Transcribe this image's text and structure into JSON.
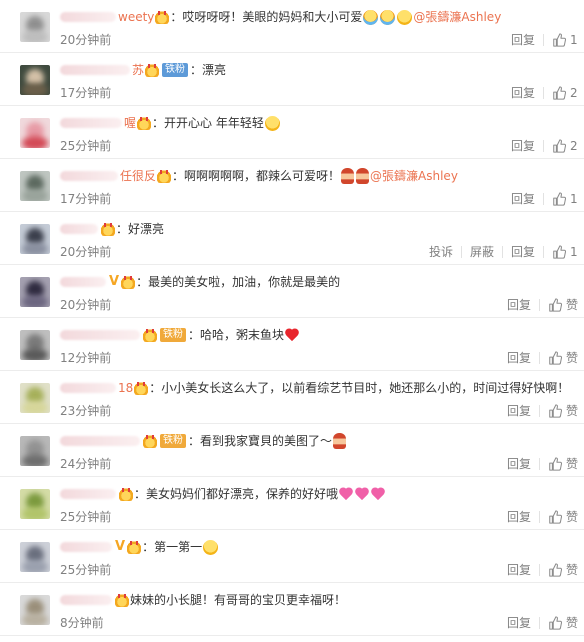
{
  "labels": {
    "reply": "回复",
    "report": "投诉",
    "block": "屏蔽",
    "like_text": "赞"
  },
  "comments": [
    {
      "name_tail": "weety",
      "badge": "",
      "content": "：哎呀呀呀！美眼的妈妈和大小可爱",
      "mention": "@張鑄濂Ashley",
      "time": "20分钟前",
      "likes": "1",
      "avatar": [
        "#d8d8d8",
        "#8f8f8f",
        "#bdbdbd"
      ]
    },
    {
      "name_tail": "苏",
      "badge": "铁粉",
      "content": "：漂亮",
      "mention": "",
      "time": "17分钟前",
      "likes": "2",
      "avatar": [
        "#3f4a3e",
        "#d4c1a8",
        "#6b5f4a"
      ]
    },
    {
      "name_tail": "喔",
      "badge": "",
      "content": "：开开心心 年年轻轻",
      "mention": "",
      "time": "25分钟前",
      "likes": "2",
      "avatar": [
        "#f0d9dc",
        "#e79aa5",
        "#d34a57"
      ]
    },
    {
      "name_tail": "任很反",
      "badge": "",
      "content": "：啊啊啊啊啊，都辣么可爱呀！",
      "mention": "@張鑄濂Ashley",
      "time": "17分钟前",
      "likes": "1",
      "avatar": [
        "#bfc6c1",
        "#5d6a60",
        "#99a39b"
      ]
    },
    {
      "name_tail": "",
      "badge": "",
      "content": "：好漂亮",
      "mention": "",
      "time": "20分钟前",
      "likes": "1",
      "avatar": [
        "#c4cbd6",
        "#3b3f4c",
        "#8a90a0"
      ],
      "extra_actions": true
    },
    {
      "name_tail": "",
      "badge": "",
      "content": "：最美的美女啦，加油，你就是最美的",
      "mention": "",
      "time": "20分钟前",
      "likes": "",
      "avatar": [
        "#a4a0b0",
        "#2f2b40",
        "#6c6680"
      ],
      "vmark": true
    },
    {
      "name_tail": "",
      "badge": "铁粉",
      "content": "：哈哈，粥末鱼块",
      "mention": "",
      "time": "12分钟前",
      "likes": "",
      "avatar": [
        "#bfbfbf",
        "#7a7a7a",
        "#5a5a5a"
      ]
    },
    {
      "name_tail": "18",
      "badge": "",
      "content": "：小小美女长这么大了，以前看综艺节目时，她还那么小的，时间过得好快啊！",
      "mention": "",
      "time": "23分钟前",
      "likes": "",
      "avatar": [
        "#e0e0c8",
        "#a6b05a",
        "#d6d69a"
      ]
    },
    {
      "name_tail": "",
      "badge": "铁粉",
      "content": "：看到我家寶貝的美图了～",
      "mention": "",
      "time": "24分钟前",
      "likes": "",
      "avatar": [
        "#b8b8b8",
        "#929292",
        "#6e6e6e"
      ]
    },
    {
      "name_tail": "",
      "badge": "",
      "content": "：美女妈妈们都好漂亮，保养的好好哦",
      "mention": "",
      "time": "25分钟前",
      "likes": "",
      "avatar": [
        "#d4dca6",
        "#7c9a3e",
        "#b1c46a"
      ]
    },
    {
      "name_tail": "",
      "badge": "",
      "content": "：第一第一",
      "mention": "",
      "time": "25分钟前",
      "likes": "",
      "avatar": [
        "#cdd0d8",
        "#6a6f7e",
        "#9aa0ae"
      ],
      "vmark": true
    },
    {
      "name_tail": "",
      "badge": "",
      "content": "妹妹的小长腿！有哥哥的宝贝更幸福呀！",
      "mention": "",
      "time": "8分钟前",
      "likes": "",
      "avatar": [
        "#d9d9d9",
        "#9a8f7a",
        "#b8b0a0"
      ]
    }
  ]
}
